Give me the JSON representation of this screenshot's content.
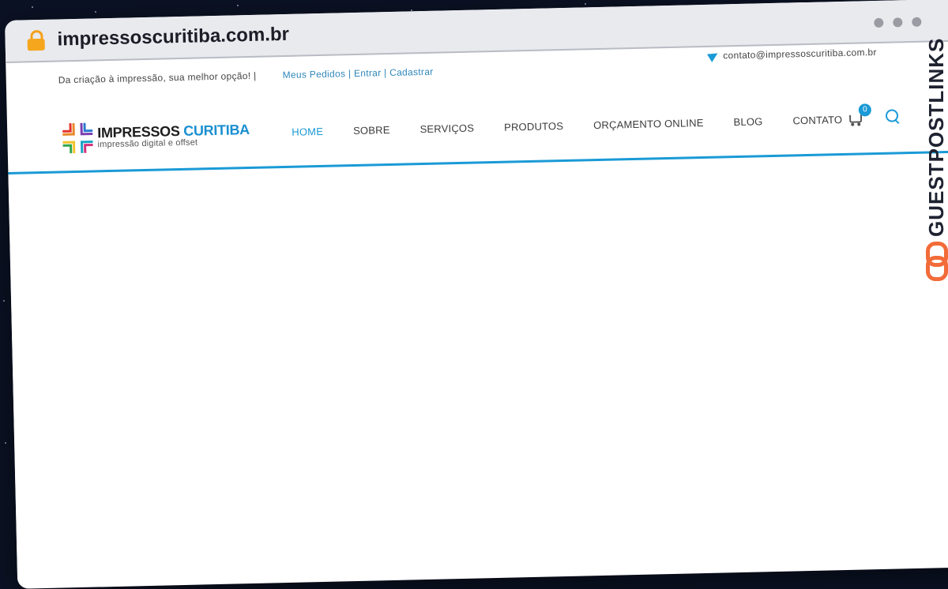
{
  "browser": {
    "url": "impressoscuritiba.com.br"
  },
  "topbar": {
    "tagline": "Da criação à impressão, sua melhor opção! |",
    "account_links": [
      "Meus Pedidos",
      "Entrar",
      "Cadastrar"
    ],
    "email": "contato@impressoscuritiba.com.br"
  },
  "logo": {
    "name_part1": "IMPRESSOS",
    "name_part2": "CURITIBA",
    "tagline": "impressão digital e offset"
  },
  "nav": {
    "items": [
      "HOME",
      "SOBRE",
      "SERVIÇOS",
      "PRODUTOS",
      "ORÇAMENTO ONLINE",
      "BLOG",
      "CONTATO"
    ],
    "active": "HOME"
  },
  "cart": {
    "count": "0"
  },
  "watermark": {
    "text": "GUESTPOSTLINKS"
  },
  "colors": {
    "accent": "#1a9ad6",
    "lock": "#f6a61d",
    "watermark_icon": "#f26b38"
  },
  "icons": [
    "lock-icon",
    "paper-plane-icon",
    "cart-icon",
    "search-icon",
    "chain-link-icon"
  ]
}
